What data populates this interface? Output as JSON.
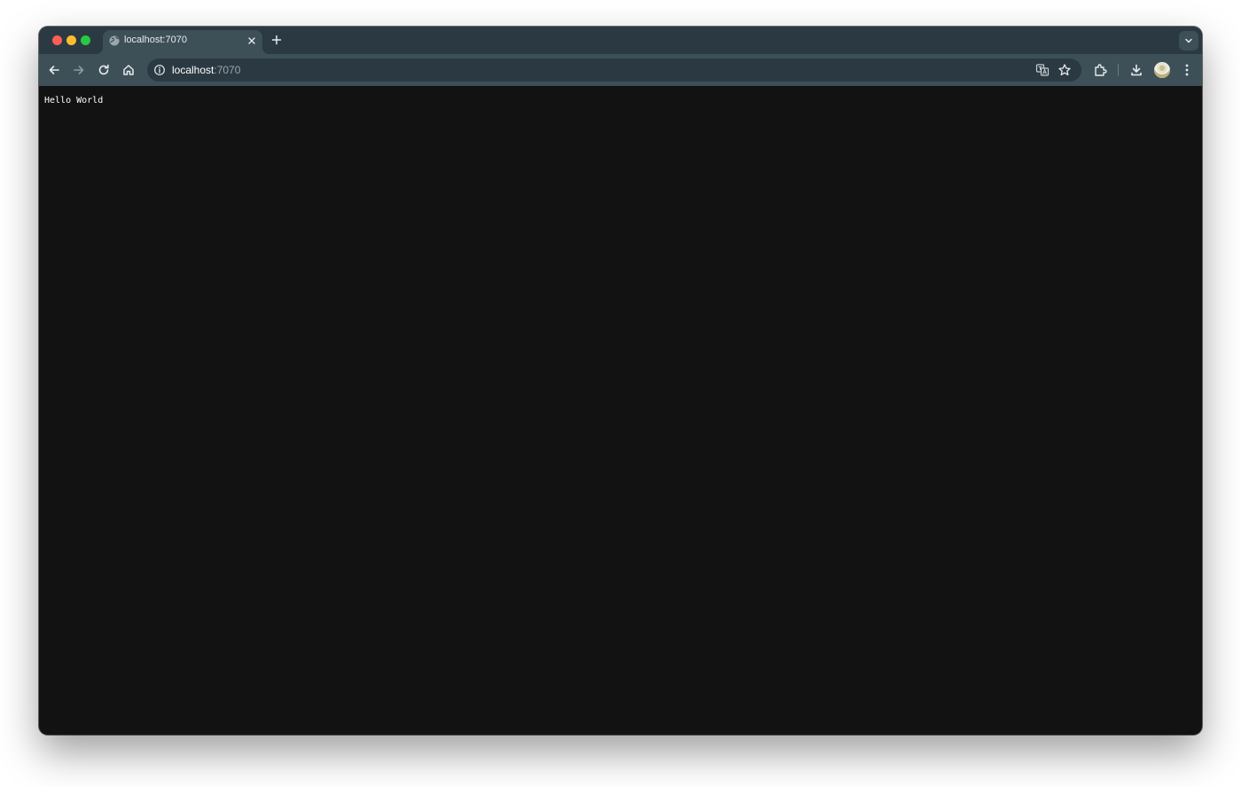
{
  "browser": {
    "tab": {
      "title": "localhost:7070",
      "favicon": "globe-icon"
    },
    "address_bar": {
      "host": "localhost",
      "port": ":7070"
    },
    "toolbar_icons": [
      "back-icon",
      "forward-icon",
      "reload-icon",
      "home-icon",
      "info-icon",
      "translate-icon",
      "star-icon",
      "extensions-icon",
      "download-icon",
      "avatar",
      "menu-icon"
    ]
  },
  "page": {
    "text": "Hello World"
  },
  "colors": {
    "tabstrip": "#2b3a42",
    "toolbar": "#3d5058",
    "page_background": "#121212",
    "close": "#ff5f57",
    "minimize": "#febc2e",
    "maximize": "#28c840"
  }
}
